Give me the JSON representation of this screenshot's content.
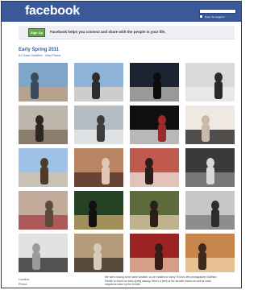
{
  "header": {
    "logo": "facebook",
    "keep_logged_in": "Keep me logged in"
  },
  "signup_bar": {
    "button_label": "Sign Up",
    "message": "Facebook helps you connect and share with the people in your life."
  },
  "album": {
    "title": "Early Spring 2011",
    "by_prefix": "By ",
    "author": "Urban Outfitters",
    "separator": " · ",
    "view_photos": "View Photos"
  },
  "photos": [
    {
      "id": "p1",
      "colors": [
        "#7fa6c9",
        "#c5a077",
        "#3a4b5f"
      ]
    },
    {
      "id": "p2",
      "colors": [
        "#8db3d6",
        "#e4d6c8",
        "#2c2c2c"
      ]
    },
    {
      "id": "p3",
      "colors": [
        "#1c2433",
        "#c4c0ba",
        "#0c0c0c"
      ]
    },
    {
      "id": "p4",
      "colors": [
        "#d9d9d9",
        "#ececec",
        "#2a2a2a"
      ]
    },
    {
      "id": "p5",
      "colors": [
        "#bdb6ab",
        "#7b6a58",
        "#2e2620"
      ]
    },
    {
      "id": "p6",
      "colors": [
        "#b4bcc4",
        "#ececec",
        "#3d3d3d"
      ]
    },
    {
      "id": "p7",
      "colors": [
        "#101010",
        "#f0f0f0",
        "#9b2a2a"
      ]
    },
    {
      "id": "p8",
      "colors": [
        "#efe9e2",
        "#1a1a1a",
        "#c8b9a8"
      ]
    },
    {
      "id": "p9",
      "colors": [
        "#9ec3e6",
        "#d4c2a2",
        "#4e3b2c"
      ]
    },
    {
      "id": "p10",
      "colors": [
        "#b88464",
        "#4d2c22",
        "#e1c7b1"
      ]
    },
    {
      "id": "p11",
      "colors": [
        "#c05a4e",
        "#f1e6dd",
        "#2a1d1a"
      ]
    },
    {
      "id": "p12",
      "colors": [
        "#3a3a3a",
        "#8b8b8b",
        "#d8d8d8"
      ]
    },
    {
      "id": "p13",
      "colors": [
        "#c2a99a",
        "#a33f43",
        "#5e4a3c"
      ]
    },
    {
      "id": "p14",
      "colors": [
        "#254225",
        "#c9a96e",
        "#111111"
      ]
    },
    {
      "id": "p15",
      "colors": [
        "#5d6a3a",
        "#e4c9a9",
        "#2b2018"
      ]
    },
    {
      "id": "p16",
      "colors": [
        "#c7c7c7",
        "#7a7a7a",
        "#2c2c2c"
      ]
    },
    {
      "id": "p17",
      "colors": [
        "#e2e2e2",
        "#222222",
        "#9a9a9a"
      ]
    },
    {
      "id": "p18",
      "colors": [
        "#b39b7c",
        "#3b2e24",
        "#d9cbb8"
      ]
    },
    {
      "id": "p19",
      "colors": [
        "#9c2324",
        "#eac9a6",
        "#3a1a14"
      ]
    },
    {
      "id": "p20",
      "colors": [
        "#c7874c",
        "#f2d3a8",
        "#3e2a1c"
      ]
    }
  ],
  "footer": {
    "location_label": "Location:",
    "photos_label": "Photos",
    "description": "We were craving some warm weather, so we headed to sunny Tel Aviv with photographer Matthew Parrish to shoot our early spring catalog. Here's a peek at her favorite photos as well as some snapshots taken by the models."
  }
}
